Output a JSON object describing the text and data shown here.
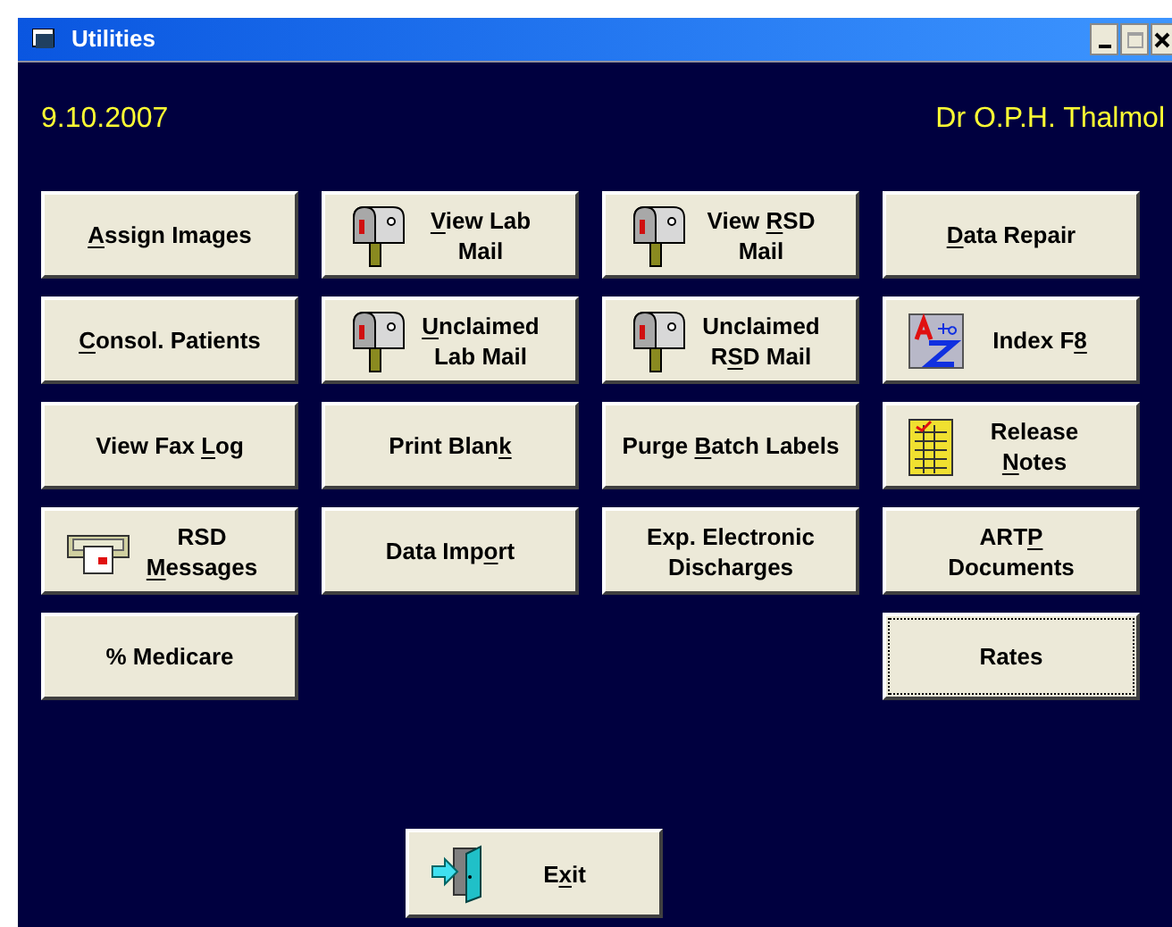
{
  "window": {
    "title": "Utilities",
    "maximize_disabled": true
  },
  "header": {
    "date": "9.10.2007",
    "user": "Dr O.P.H. Thalmol"
  },
  "columns": [
    [
      {
        "kind": "text",
        "focused": false,
        "lines": [
          [
            {
              "text": "A",
              "underlined": true
            },
            {
              "text": "ssign Images",
              "underlined": false
            }
          ]
        ]
      },
      {
        "kind": "text",
        "focused": false,
        "lines": [
          [
            {
              "text": "C",
              "underlined": true
            },
            {
              "text": "onsol. Patients",
              "underlined": false
            }
          ]
        ]
      },
      {
        "kind": "text",
        "focused": false,
        "lines": [
          [
            {
              "text": "View Fax ",
              "underlined": false
            },
            {
              "text": "L",
              "underlined": true
            },
            {
              "text": "og",
              "underlined": false
            }
          ]
        ]
      },
      {
        "kind": "fax",
        "focused": false,
        "lines": [
          [
            {
              "text": "RSD",
              "underlined": false
            }
          ],
          [
            {
              "text": "M",
              "underlined": true
            },
            {
              "text": "essages",
              "underlined": false
            }
          ]
        ]
      },
      {
        "kind": "text",
        "focused": false,
        "lines": [
          [
            {
              "text": "% Medicare",
              "underlined": false
            }
          ]
        ]
      }
    ],
    [
      {
        "kind": "mailbox",
        "focused": false,
        "lines": [
          [
            {
              "text": "V",
              "underlined": true
            },
            {
              "text": "iew Lab",
              "underlined": false
            }
          ],
          [
            {
              "text": "Mail",
              "underlined": false
            }
          ]
        ]
      },
      {
        "kind": "mailbox",
        "focused": false,
        "lines": [
          [
            {
              "text": "U",
              "underlined": true
            },
            {
              "text": "nclaimed",
              "underlined": false
            }
          ],
          [
            {
              "text": "Lab Mail",
              "underlined": false
            }
          ]
        ]
      },
      {
        "kind": "text",
        "focused": false,
        "lines": [
          [
            {
              "text": "Print Blan",
              "underlined": false
            },
            {
              "text": "k",
              "underlined": true
            }
          ]
        ]
      },
      {
        "kind": "text",
        "focused": false,
        "lines": [
          [
            {
              "text": "Data Imp",
              "underlined": false
            },
            {
              "text": "o",
              "underlined": true
            },
            {
              "text": "rt",
              "underlined": false
            }
          ]
        ]
      }
    ],
    [
      {
        "kind": "mailbox",
        "focused": false,
        "lines": [
          [
            {
              "text": "View ",
              "underlined": false
            },
            {
              "text": "R",
              "underlined": true
            },
            {
              "text": "SD",
              "underlined": false
            }
          ],
          [
            {
              "text": "Mail",
              "underlined": false
            }
          ]
        ]
      },
      {
        "kind": "mailbox",
        "focused": false,
        "lines": [
          [
            {
              "text": "Unclaimed",
              "underlined": false
            }
          ],
          [
            {
              "text": "R",
              "underlined": false
            },
            {
              "text": "S",
              "underlined": true
            },
            {
              "text": "D Mail",
              "underlined": false
            }
          ]
        ]
      },
      {
        "kind": "text",
        "focused": false,
        "lines": [
          [
            {
              "text": "Purge ",
              "underlined": false
            },
            {
              "text": "B",
              "underlined": true
            },
            {
              "text": "atch Labels",
              "underlined": false
            }
          ]
        ]
      },
      {
        "kind": "text",
        "focused": false,
        "lines": [
          [
            {
              "text": "Exp. Electronic",
              "underlined": false
            }
          ],
          [
            {
              "text": "Discharges",
              "underlined": false
            }
          ]
        ]
      }
    ],
    [
      {
        "kind": "text",
        "focused": false,
        "lines": [
          [
            {
              "text": "D",
              "underlined": true
            },
            {
              "text": "ata Repair",
              "underlined": false
            }
          ]
        ]
      },
      {
        "kind": "atoz",
        "focused": false,
        "lines": [
          [
            {
              "text": "Index F",
              "underlined": false
            },
            {
              "text": "8",
              "underlined": true
            }
          ]
        ]
      },
      {
        "kind": "notes",
        "focused": false,
        "lines": [
          [
            {
              "text": "Release",
              "underlined": false
            }
          ],
          [
            {
              "text": "N",
              "underlined": true
            },
            {
              "text": "otes",
              "underlined": false
            }
          ]
        ]
      },
      {
        "kind": "text",
        "focused": false,
        "lines": [
          [
            {
              "text": "ART",
              "underlined": false
            },
            {
              "text": "P",
              "underlined": true
            }
          ],
          [
            {
              "text": "Documents",
              "underlined": false
            }
          ]
        ]
      },
      {
        "kind": "text",
        "focused": true,
        "lines": [
          [
            {
              "text": "Rates",
              "underlined": false
            }
          ]
        ]
      }
    ]
  ],
  "exit": {
    "kind": "exit",
    "focused": false,
    "lines": [
      [
        {
          "text": "E",
          "underlined": false
        },
        {
          "text": "x",
          "underlined": true
        },
        {
          "text": "it",
          "underlined": false
        }
      ]
    ]
  }
}
